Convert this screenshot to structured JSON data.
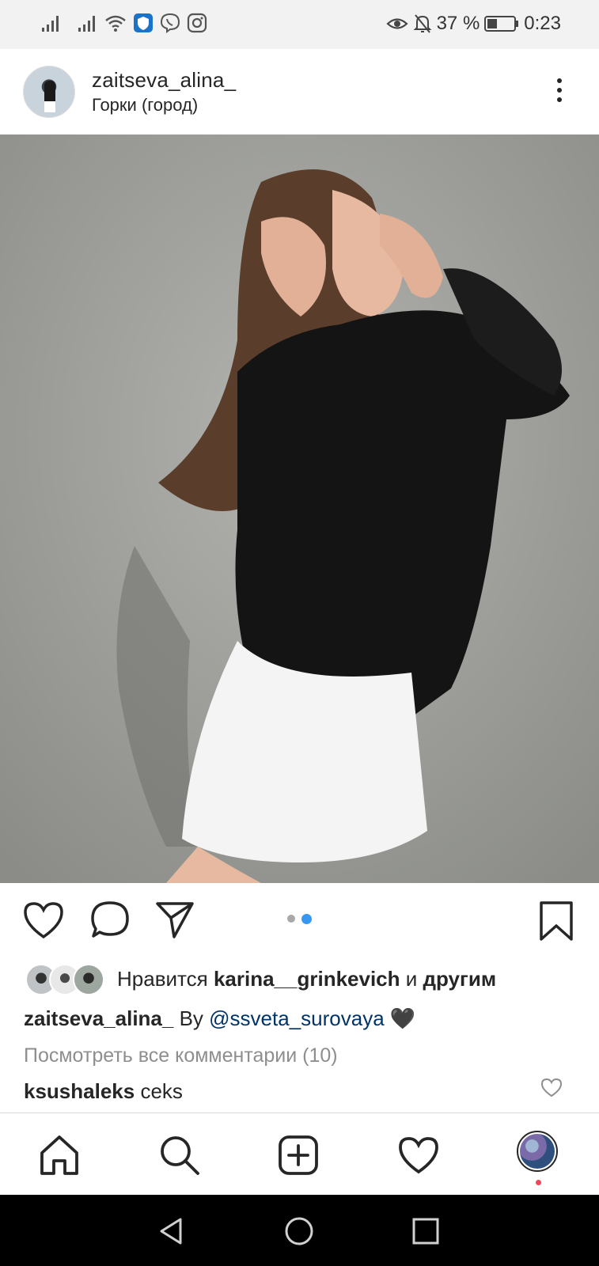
{
  "status_bar": {
    "battery_percent": "37 %",
    "time": "0:23",
    "icons": [
      "signal-icon",
      "signal-icon",
      "wifi-icon",
      "shield-app-icon",
      "viber-icon",
      "instagram-icon",
      "eye-icon",
      "bell-off-icon",
      "battery-icon"
    ],
    "battery_level": 0.37
  },
  "post": {
    "username": "zaitseva_alina_",
    "location": "Горки (город)",
    "photo_alt": "",
    "carousel": {
      "total": 2,
      "current": 2
    }
  },
  "likes": {
    "prefix": "Нравится ",
    "user": "karina__grinkevich",
    "middle": " и ",
    "others": "другим"
  },
  "caption": {
    "username": "zaitseva_alina_",
    "text": " By ",
    "mention": "@ssveta_surovaya",
    "emoji": " 🖤"
  },
  "view_all_comments": "Посмотреть все комментарии (10)",
  "comment": {
    "username": "ksushaleks",
    "text": " ceks"
  },
  "bottom_nav": {
    "items": [
      "home-icon",
      "search-icon",
      "new-post-icon",
      "activity-icon",
      "profile-avatar"
    ]
  },
  "system_nav": [
    "back-icon",
    "home-circle-icon",
    "recents-icon"
  ],
  "colors": {
    "accent": "#3897f0",
    "mention": "#003569",
    "muted": "#8e8e8e",
    "notification": "#ed4956"
  }
}
